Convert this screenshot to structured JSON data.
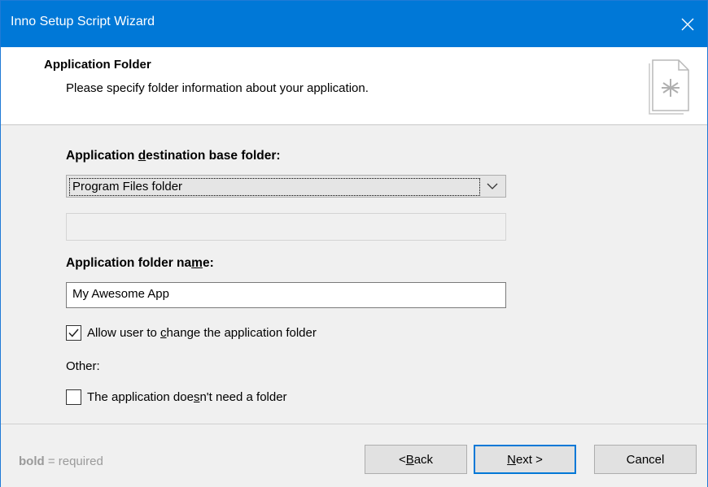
{
  "window": {
    "title": "Inno Setup Script Wizard"
  },
  "header": {
    "title": "Application Folder",
    "subtitle": "Please specify folder information about your application.",
    "icon": "wizard-page-icon"
  },
  "form": {
    "base_folder_label": {
      "pre": "Application ",
      "key": "d",
      "post": "estination base folder:"
    },
    "base_folder_selected": "Program Files folder",
    "base_folder_custom_value": "",
    "folder_name_label": {
      "pre": "Application folder na",
      "key": "m",
      "post": "e:"
    },
    "folder_name_value": "My Awesome App",
    "allow_change": {
      "pre": "Allow user to ",
      "key": "c",
      "post": "hange the application folder",
      "checked": true
    },
    "other_label": "Other:",
    "no_folder": {
      "pre": "The application doe",
      "key": "s",
      "post": "n't need a folder",
      "checked": false
    }
  },
  "footer": {
    "hint_bold": "bold",
    "hint_rest": " = required",
    "back": {
      "pre": "< ",
      "key": "B",
      "post": "ack"
    },
    "next": {
      "pre": "",
      "key": "N",
      "post": "ext >"
    },
    "cancel": "Cancel"
  },
  "colors": {
    "titlebar": "#0078d7",
    "default_button_border": "#0078d7"
  }
}
